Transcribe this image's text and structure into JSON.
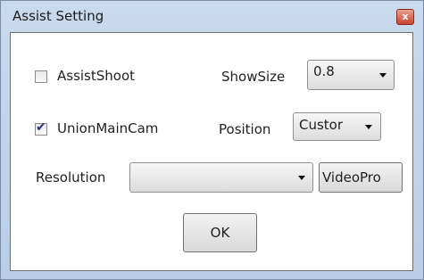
{
  "window": {
    "title": "Assist Setting",
    "close_glyph": "x"
  },
  "assist_shoot": {
    "label": "AssistShoot",
    "checked": false
  },
  "show_size": {
    "label": "ShowSize",
    "value": "0.8"
  },
  "union_main_cam": {
    "label": "UnionMainCam",
    "checked": true
  },
  "position": {
    "label": "Position",
    "value": "Custor"
  },
  "resolution": {
    "label": "Resolution",
    "value": ""
  },
  "video_prop_button": {
    "label": "VideoPro"
  },
  "ok_button": {
    "label": "OK"
  }
}
